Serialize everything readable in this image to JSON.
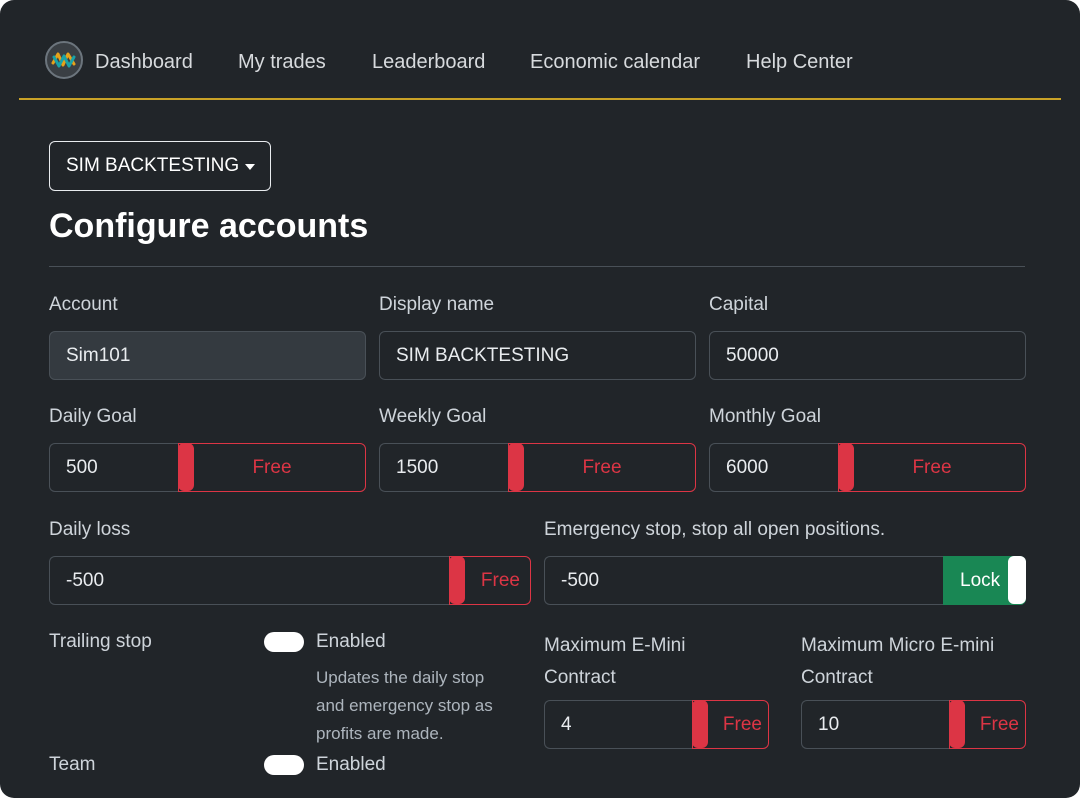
{
  "nav": {
    "items": [
      "Dashboard",
      "My trades",
      "Leaderboard",
      "Economic calendar",
      "Help Center"
    ],
    "logo_icon": "wave-logo-icon"
  },
  "account_selector": {
    "label": "SIM BACKTESTING"
  },
  "page": {
    "title": "Configure accounts"
  },
  "form": {
    "account": {
      "label": "Account",
      "value": "Sim101"
    },
    "display_name": {
      "label": "Display name",
      "value": "SIM BACKTESTING"
    },
    "capital": {
      "label": "Capital",
      "value": "50000"
    },
    "daily_goal": {
      "label": "Daily Goal",
      "value": "500",
      "toggle": "Free"
    },
    "weekly_goal": {
      "label": "Weekly Goal",
      "value": "1500",
      "toggle": "Free"
    },
    "monthly_goal": {
      "label": "Monthly Goal",
      "value": "6000",
      "toggle": "Free"
    },
    "daily_loss": {
      "label": "Daily loss",
      "value": "-500",
      "toggle": "Free"
    },
    "emergency_stop": {
      "label": "Emergency stop, stop all open positions.",
      "value": "-500",
      "toggle": "Lock"
    },
    "trailing_stop": {
      "label": "Trailing stop",
      "switch_label": "Enabled",
      "help": "Updates the daily stop and emergency stop as profits are made."
    },
    "team": {
      "label": "Team",
      "switch_label": "Enabled"
    },
    "max_emini": {
      "label": "Maximum E-Mini Contract",
      "value": "4",
      "toggle": "Free"
    },
    "max_micro": {
      "label": "Maximum Micro E-mini Contract",
      "value": "10",
      "toggle": "Free"
    }
  },
  "colors": {
    "background": "#212529",
    "accent_line": "#c9a227",
    "free_red": "#dc3545",
    "lock_green": "#198754"
  }
}
